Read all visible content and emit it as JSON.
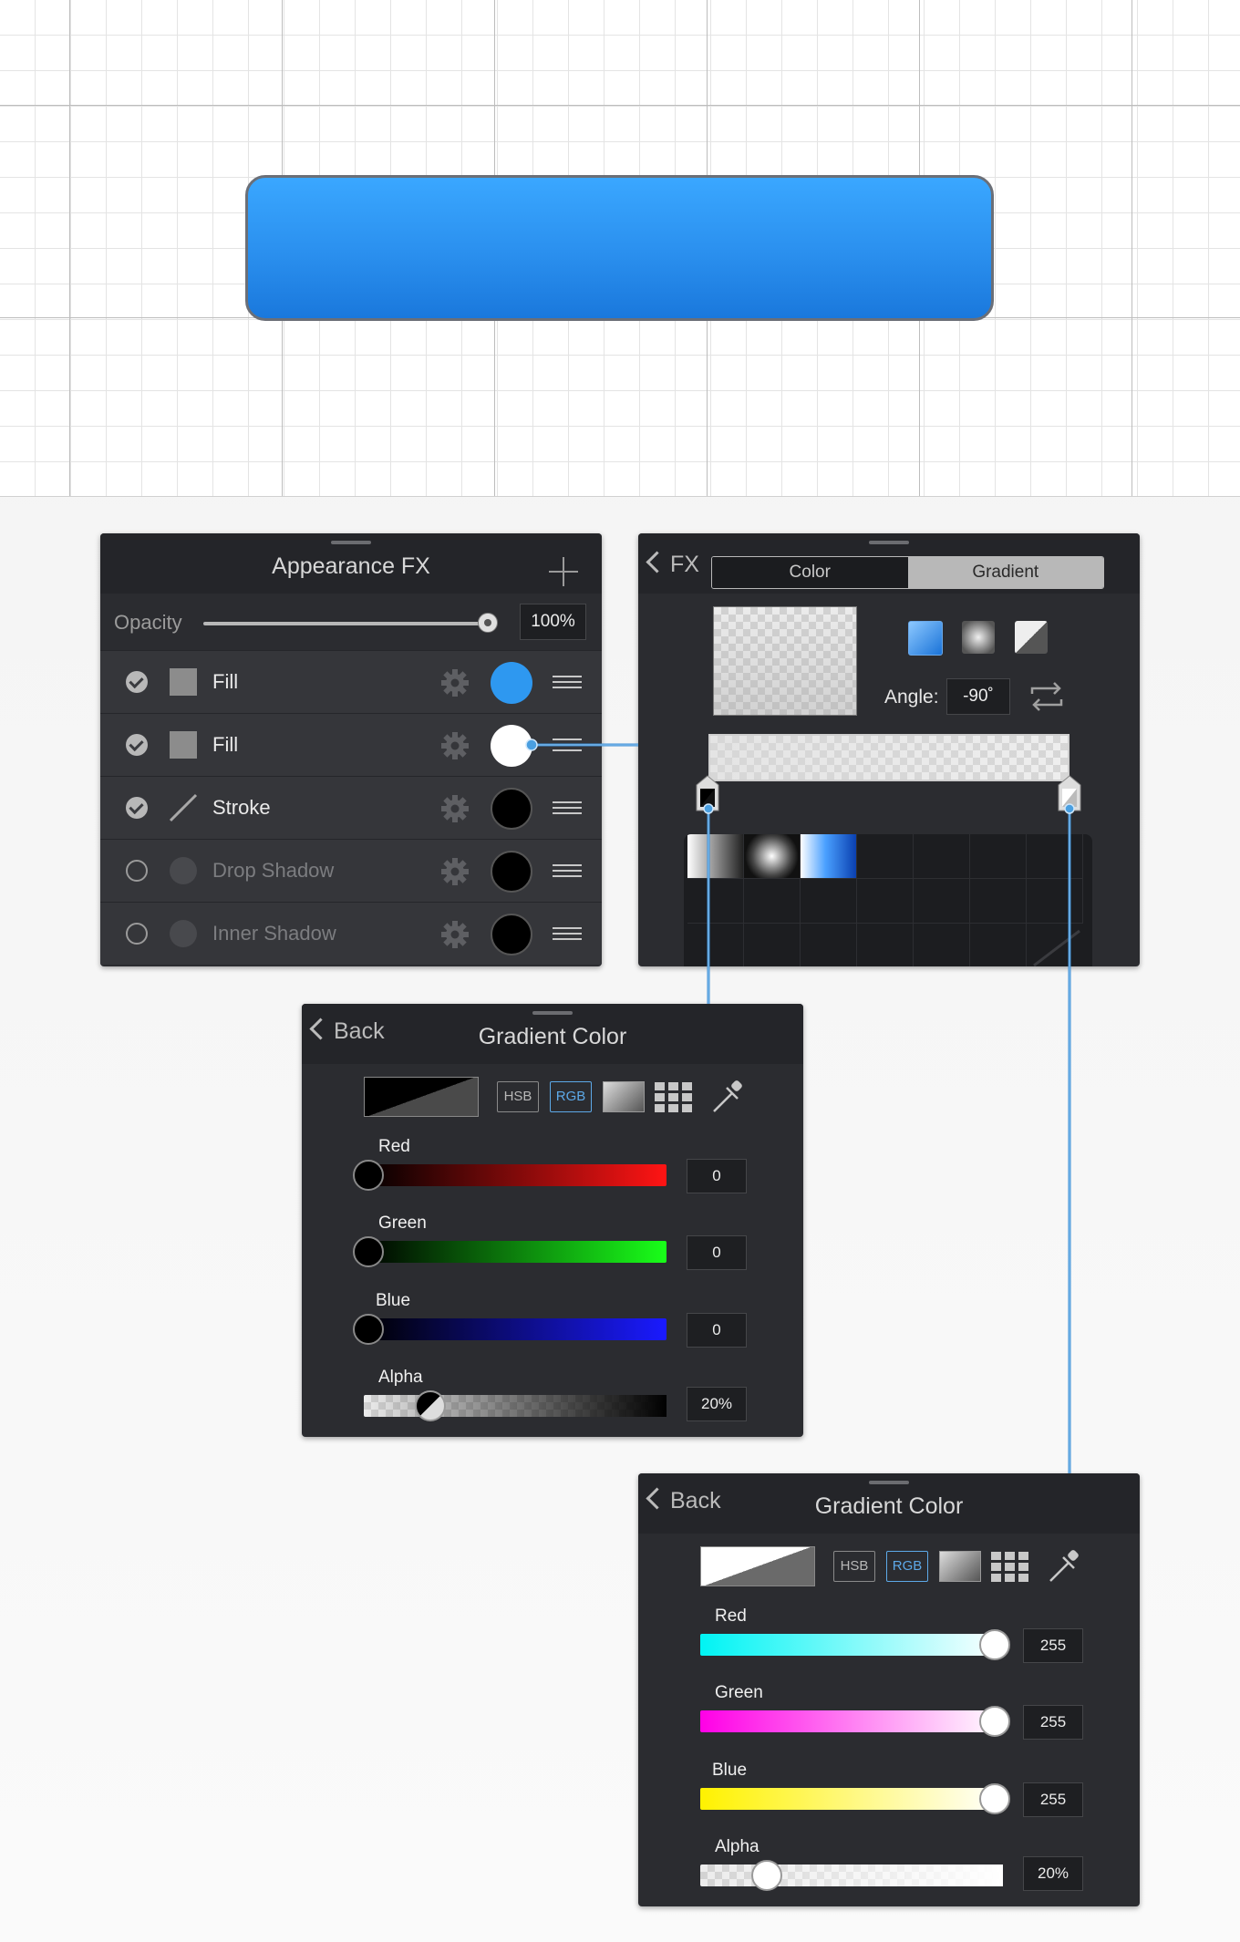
{
  "canvas": {
    "button_color": "#2a8fee"
  },
  "appearance": {
    "title": "Appearance FX",
    "opacity_label": "Opacity",
    "opacity_value": "100%",
    "layers": [
      {
        "label": "Fill",
        "enabled": true,
        "icon": "fill-swatch-icon",
        "color": "#2e98f0"
      },
      {
        "label": "Fill",
        "enabled": true,
        "icon": "fill-swatch-icon",
        "color": "#ffffff"
      },
      {
        "label": "Stroke",
        "enabled": true,
        "icon": "stroke-line-icon",
        "color": "black/white split"
      },
      {
        "label": "Drop Shadow",
        "enabled": false,
        "icon": "shadow-icon",
        "color": "black/white split"
      },
      {
        "label": "Inner Shadow",
        "enabled": false,
        "icon": "shadow-icon",
        "color": "black/white split"
      }
    ]
  },
  "gradient": {
    "back_label": "FX",
    "tab_color": "Color",
    "tab_gradient": "Gradient",
    "angle_label": "Angle:",
    "angle_value": "-90˚"
  },
  "gradient_color_dark": {
    "back_label": "Back",
    "title": "Gradient Color",
    "mode_hsb": "HSB",
    "mode_rgb": "RGB",
    "red_label": "Red",
    "red_value": "0",
    "green_label": "Green",
    "green_value": "0",
    "blue_label": "Blue",
    "blue_value": "0",
    "alpha_label": "Alpha",
    "alpha_value": "20%"
  },
  "gradient_color_light": {
    "back_label": "Back",
    "title": "Gradient Color",
    "mode_hsb": "HSB",
    "mode_rgb": "RGB",
    "red_label": "Red",
    "red_value": "255",
    "green_label": "Green",
    "green_value": "255",
    "blue_label": "Blue",
    "blue_value": "255",
    "alpha_label": "Alpha",
    "alpha_value": "20%"
  },
  "colors": {
    "accent": "#5da9e8",
    "connector": "#4a9fe0",
    "panel": "#2b2c30"
  }
}
